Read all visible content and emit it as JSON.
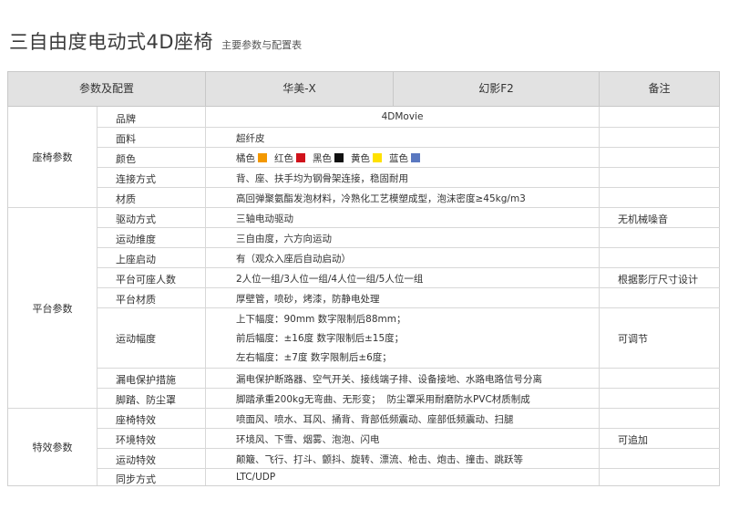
{
  "title": {
    "main": "三自由度电动式4D座椅",
    "sub": "主要参数与配置表"
  },
  "header": {
    "col1": "参数及配置",
    "col2": "华美-X",
    "col3": "幻影F2",
    "col4": "备注"
  },
  "categories": {
    "seat": "座椅参数",
    "platform": "平台参数",
    "effects": "特效参数"
  },
  "rows": {
    "brand": {
      "label": "品牌",
      "value": "4DMovie"
    },
    "fabric": {
      "label": "面料",
      "value": "超纤皮"
    },
    "color": {
      "label": "颜色"
    },
    "connection": {
      "label": "连接方式",
      "value": "背、座、扶手均为钢骨架连接，稳固耐用"
    },
    "material": {
      "label": "材质",
      "value": "高回弹聚氨酯发泡材料，冷熟化工艺模塑成型，泡沫密度≥45kg/m3"
    },
    "drive": {
      "label": "驱动方式",
      "value": "三轴电动驱动",
      "note": "无机械噪音"
    },
    "dimension": {
      "label": "运动维度",
      "value": "三自由度，六方向运动"
    },
    "boarding": {
      "label": "上座启动",
      "value": "有（观众入座后自动启动）"
    },
    "capacity": {
      "label": "平台可座人数",
      "value": "2人位一组/3人位一组/4人位一组/5人位一组",
      "note": "根据影厅尺寸设计"
    },
    "platform_material": {
      "label": "平台材质",
      "value": "厚壁管，喷砂，烤漆，防静电处理"
    },
    "amplitude": {
      "label": "运动幅度",
      "line1": "上下幅度：90mm 数字限制后88mm；",
      "line2": "前后幅度：±16度 数字限制后±15度；",
      "line3": "左右幅度：±7度 数字限制后±6度；",
      "note": "可调节"
    },
    "leakage": {
      "label": "漏电保护措施",
      "value": "漏电保护断路器、空气开关、接线端子排、设备接地、水路电路信号分离"
    },
    "footrest": {
      "label": "脚踏、防尘罩",
      "value": "脚踏承重200kg无弯曲、无形变；  防尘罩采用耐磨防水PVC材质制成"
    },
    "seat_effects": {
      "label": "座椅特效",
      "value": "喷面风、喷水、耳风、捅背、背部低频震动、座部低频震动、扫腿"
    },
    "env_effects": {
      "label": "环境特效",
      "value": "环境风、下雪、烟雾、泡泡、闪电",
      "note": "可追加"
    },
    "motion_effects": {
      "label": "运动特效",
      "value": "颠簸、飞行、打斗、颤抖、旋转、漂流、枪击、炮击、撞击、跳跃等"
    },
    "sync": {
      "label": "同步方式",
      "value": "LTC/UDP"
    }
  },
  "colors": [
    {
      "name": "橘色",
      "hex": "#f39800"
    },
    {
      "name": "红色",
      "hex": "#d0121b"
    },
    {
      "name": "黑色",
      "hex": "#111111"
    },
    {
      "name": "黄色",
      "hex": "#ffe100"
    },
    {
      "name": "蓝色",
      "hex": "#5a78c0"
    }
  ]
}
